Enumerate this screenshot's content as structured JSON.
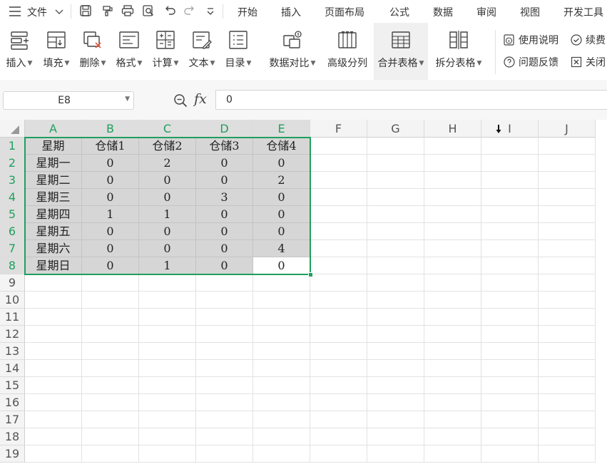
{
  "menu": {
    "file": "文件",
    "tabs": [
      "开始",
      "插入",
      "页面布局",
      "公式",
      "数据",
      "审阅",
      "视图",
      "开发工具"
    ]
  },
  "ribbon": {
    "buttons": [
      {
        "label": "插入",
        "icon": "insert-icon"
      },
      {
        "label": "填充",
        "icon": "fill-icon"
      },
      {
        "label": "删除",
        "icon": "delete-icon"
      },
      {
        "label": "格式",
        "icon": "format-icon"
      },
      {
        "label": "计算",
        "icon": "calculator-icon"
      },
      {
        "label": "文本",
        "icon": "text-icon"
      },
      {
        "label": "目录",
        "icon": "catalog-icon"
      },
      {
        "label": "数据对比",
        "icon": "data-compare-icon"
      },
      {
        "label": "高级分列",
        "icon": "advanced-split-icon"
      },
      {
        "label": "合并表格",
        "icon": "merge-table-icon"
      },
      {
        "label": "拆分表格",
        "icon": "split-table-icon"
      }
    ],
    "usage_guide": "使用说明",
    "renew": "续费",
    "feedback": "问题反馈",
    "close": "关闭"
  },
  "formula_bar": {
    "cell_ref": "E8",
    "fx_label": "fx",
    "value": "0"
  },
  "sheet": {
    "columns": [
      "A",
      "B",
      "C",
      "D",
      "E",
      "F",
      "G",
      "H",
      "I",
      "J"
    ],
    "rows": [
      "1",
      "2",
      "3",
      "4",
      "5",
      "6",
      "7",
      "8",
      "9",
      "10",
      "11",
      "12",
      "13",
      "14",
      "15",
      "16",
      "17",
      "18",
      "19"
    ],
    "cells": [
      [
        "星期",
        "仓储1",
        "仓储2",
        "仓储3",
        "仓储4"
      ],
      [
        "星期一",
        "0",
        "2",
        "0",
        "0"
      ],
      [
        "星期二",
        "0",
        "0",
        "0",
        "2"
      ],
      [
        "星期三",
        "0",
        "0",
        "3",
        "0"
      ],
      [
        "星期四",
        "1",
        "1",
        "0",
        "0"
      ],
      [
        "星期五",
        "0",
        "0",
        "0",
        "0"
      ],
      [
        "星期六",
        "0",
        "0",
        "0",
        "4"
      ],
      [
        "星期日",
        "0",
        "1",
        "0",
        "0"
      ]
    ],
    "accent_color": "#1f9f5e"
  }
}
